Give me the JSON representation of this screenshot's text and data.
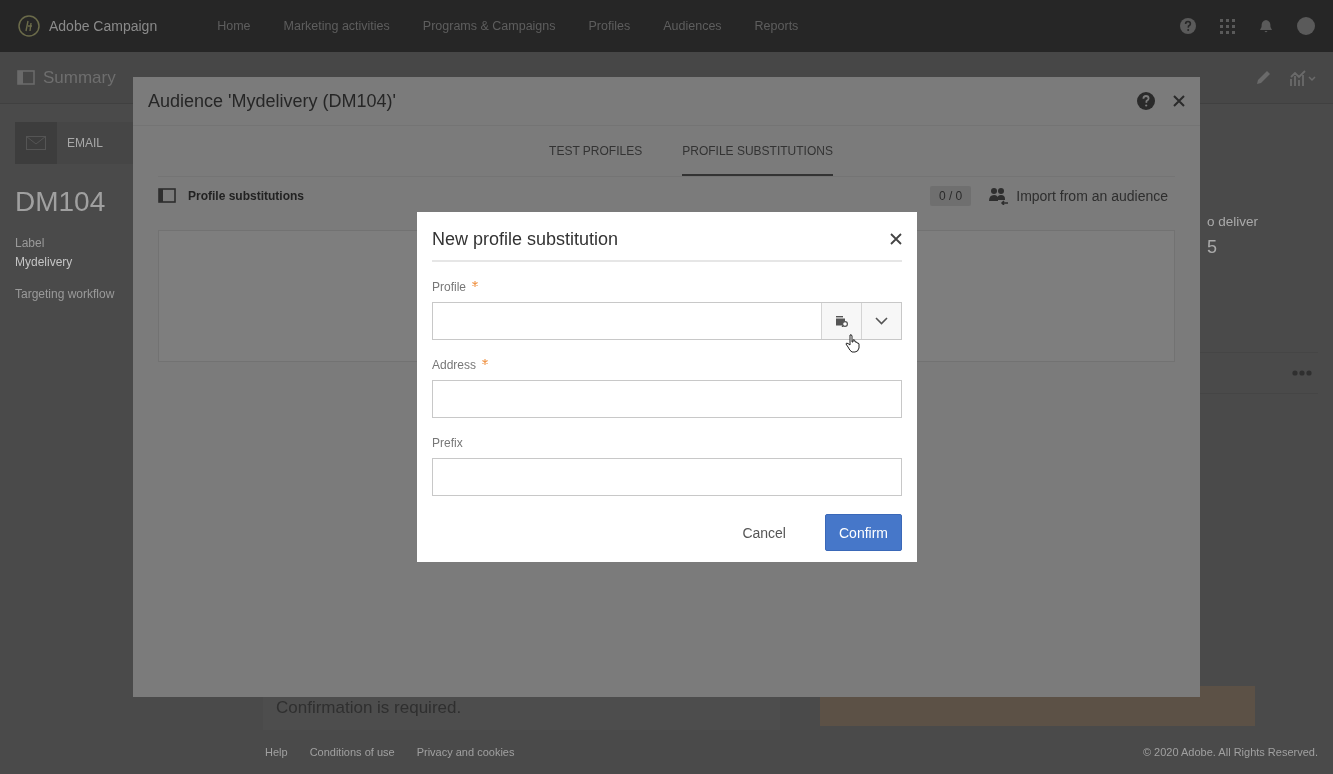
{
  "nav": {
    "product": "Adobe Campaign",
    "items": [
      "Home",
      "Marketing activities",
      "Programs & Campaigns",
      "Profiles",
      "Audiences",
      "Reports"
    ]
  },
  "subheader": {
    "title": "Summary"
  },
  "sidebar": {
    "channel": "EMAIL",
    "code": "DM104",
    "fields": [
      {
        "label": "Label",
        "value": "Mydelivery"
      },
      {
        "label": "Targeting workflow"
      }
    ]
  },
  "side_card": {
    "heading": "o deliver",
    "value": "5"
  },
  "message": "Confirmation is required.",
  "footer": {
    "links": [
      "Help",
      "Conditions of use",
      "Privacy and cookies"
    ],
    "copyright": "© 2020 Adobe. All Rights Reserved."
  },
  "audience_dialog": {
    "title": "Audience 'Mydelivery (DM104)'",
    "tabs": [
      {
        "label": "TEST PROFILES",
        "selected": false
      },
      {
        "label": "PROFILE SUBSTITUTIONS",
        "selected": true
      }
    ],
    "section_title": "Profile substitutions",
    "count": "0 / 0",
    "import_label": "Import from an audience"
  },
  "substitution_dialog": {
    "title": "New profile substitution",
    "fields": [
      {
        "label": "Profile",
        "required": true,
        "kind": "lookup"
      },
      {
        "label": "Address",
        "required": true,
        "kind": "text"
      },
      {
        "label": "Prefix",
        "required": false,
        "kind": "text"
      }
    ],
    "buttons": [
      {
        "label": "Cancel",
        "kind": "secondary"
      },
      {
        "label": "Confirm",
        "kind": "primary"
      }
    ]
  }
}
